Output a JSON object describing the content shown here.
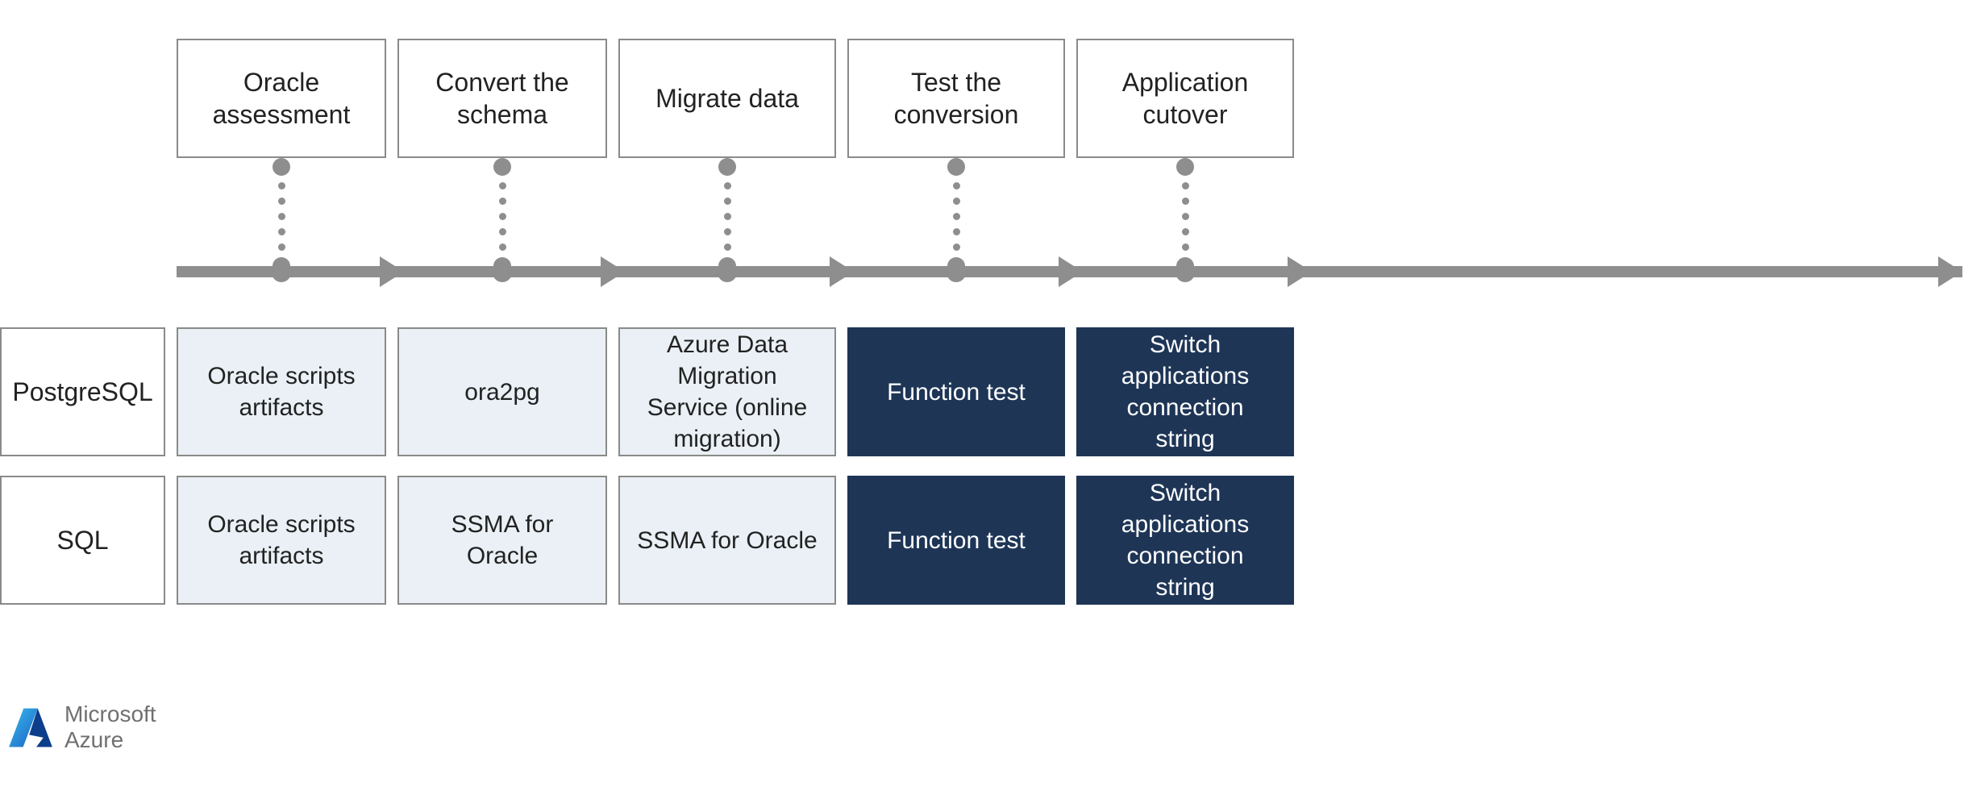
{
  "phases": {
    "p1": "Oracle assessment",
    "p2": "Convert the schema",
    "p3": "Migrate data",
    "p4": "Test the conversion",
    "p5": "Application cutover"
  },
  "rows": {
    "postgres": {
      "label": "PostgreSQL",
      "c1": "Oracle scripts artifacts",
      "c2": "ora2pg",
      "c3": "Azure Data Migration Service (online migration)",
      "c4": "Function test",
      "c5": "Switch applications connection string"
    },
    "sql": {
      "label": "SQL",
      "c1": "Oracle scripts artifacts",
      "c2": "SSMA for Oracle",
      "c3": "SSMA for Oracle",
      "c4": "Function test",
      "c5": "Switch applications connection string"
    }
  },
  "brand": {
    "line1": "Microsoft",
    "line2": "Azure"
  },
  "colors": {
    "light_bg": "#eaf0f5",
    "dark_bg": "#1e3556",
    "arrow": "#8e8e8e",
    "azure_blue": "#0078d4"
  }
}
